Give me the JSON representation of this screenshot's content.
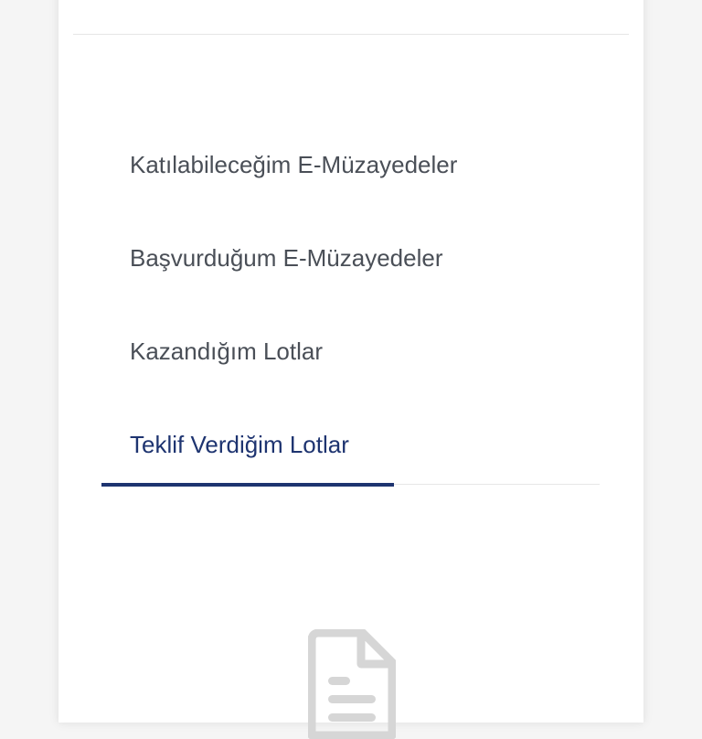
{
  "tabs": [
    {
      "label": "Katılabileceğim E-Müzayedeler",
      "active": false
    },
    {
      "label": "Başvurduğum E-Müzayedeler",
      "active": false
    },
    {
      "label": "Kazandığım Lotlar",
      "active": false
    },
    {
      "label": "Teklif Verdiğim Lotlar",
      "active": true
    }
  ],
  "colors": {
    "active_tab": "#1e3470",
    "inactive_tab": "#4a4f57",
    "icon": "#d6d6d6"
  },
  "empty_state": {
    "icon": "document-icon"
  }
}
